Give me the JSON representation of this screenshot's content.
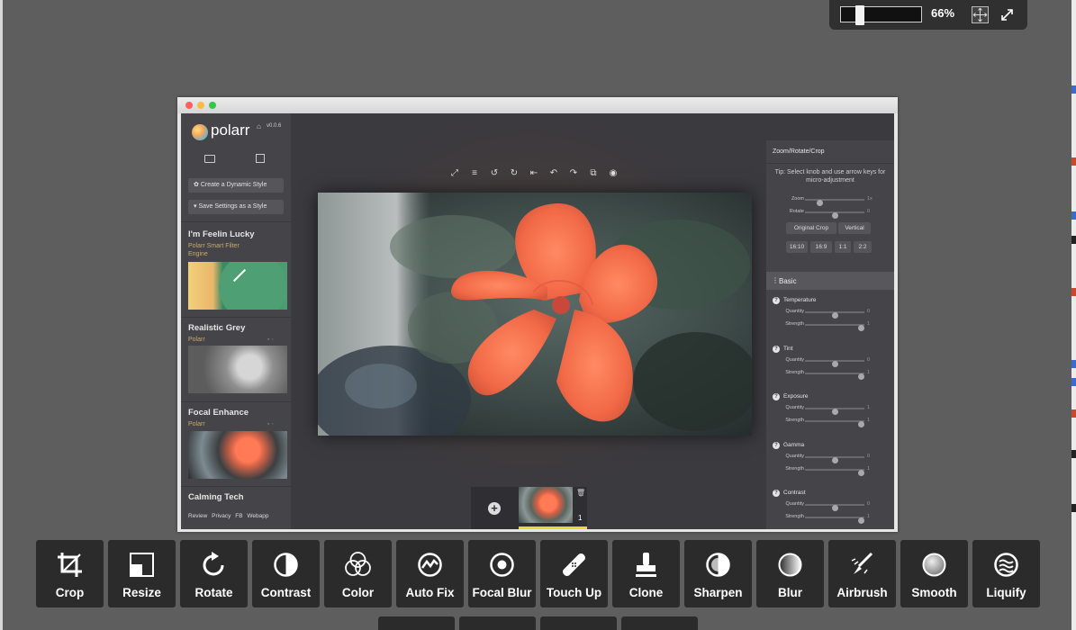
{
  "zoom": {
    "value": "66%",
    "level": 0.12
  },
  "app": {
    "brand": "polarr",
    "version": "v0.0.6",
    "sidebar": {
      "create_style": "Create a Dynamic Style",
      "save_settings": "Save Settings as a Style",
      "filters": [
        {
          "title": "I'm Feelin Lucky",
          "subtitle": "Polarr Smart Filter Engine"
        },
        {
          "title": "Realistic Grey",
          "subtitle": "Polarr"
        },
        {
          "title": "Focal Enhance",
          "subtitle": "Polarr"
        },
        {
          "title": "Calming Tech",
          "subtitle": ""
        }
      ],
      "links": "Review  Privacy  FB  Webapp"
    },
    "panel": {
      "header": "Zoom/Rotate/Crop",
      "tip": "Tip: Select knob and use arrow keys for micro-adjustment",
      "zoom": {
        "label": "Zoom",
        "value": "1x",
        "level": 0.25
      },
      "rotate": {
        "label": "Rotate",
        "value": "0",
        "level": 0.5
      },
      "original_crop": "Original Crop",
      "vertical": "Vertical",
      "ratios": [
        "16:10",
        "16:9",
        "1:1",
        "2:2"
      ],
      "section": "Basic",
      "adjustments": [
        {
          "title": "Temperature",
          "quantity": {
            "label": "Quantity",
            "value": "0",
            "level": 0.5
          },
          "strength": {
            "label": "Strength",
            "value": "1",
            "level": 0.95
          }
        },
        {
          "title": "Tint",
          "quantity": {
            "label": "Quantity",
            "value": "0",
            "level": 0.5
          },
          "strength": {
            "label": "Strength",
            "value": "1",
            "level": 0.95
          }
        },
        {
          "title": "Exposure",
          "quantity": {
            "label": "Quantity",
            "value": "1",
            "level": 0.5
          },
          "strength": {
            "label": "Strength",
            "value": "1",
            "level": 0.95
          }
        },
        {
          "title": "Gamma",
          "quantity": {
            "label": "Quantity",
            "value": "0",
            "level": 0.5
          },
          "strength": {
            "label": "Strength",
            "value": "1",
            "level": 0.95
          }
        },
        {
          "title": "Contrast",
          "quantity": {
            "label": "Quantity",
            "value": "0",
            "level": 0.5
          },
          "strength": {
            "label": "Strength",
            "value": "1",
            "level": 0.95
          }
        }
      ]
    },
    "filmstrip": {
      "count": "1"
    }
  },
  "tools": [
    {
      "label": "Crop",
      "icon": "crop-icon"
    },
    {
      "label": "Resize",
      "icon": "resize-icon"
    },
    {
      "label": "Rotate",
      "icon": "rotate-icon"
    },
    {
      "label": "Contrast",
      "icon": "contrast-icon"
    },
    {
      "label": "Color",
      "icon": "color-icon"
    },
    {
      "label": "Auto Fix",
      "icon": "auto-fix-icon"
    },
    {
      "label": "Focal Blur",
      "icon": "focal-blur-icon"
    },
    {
      "label": "Touch Up",
      "icon": "touch-up-icon"
    },
    {
      "label": "Clone",
      "icon": "clone-icon"
    },
    {
      "label": "Sharpen",
      "icon": "sharpen-icon"
    },
    {
      "label": "Blur",
      "icon": "blur-icon"
    },
    {
      "label": "Airbrush",
      "icon": "airbrush-icon"
    },
    {
      "label": "Smooth",
      "icon": "smooth-icon"
    },
    {
      "label": "Liquify",
      "icon": "liquify-icon"
    }
  ],
  "colors": {
    "accent": "#e8d83a",
    "flower": "#f2704e",
    "tool_bg": "#2b2b2b"
  }
}
